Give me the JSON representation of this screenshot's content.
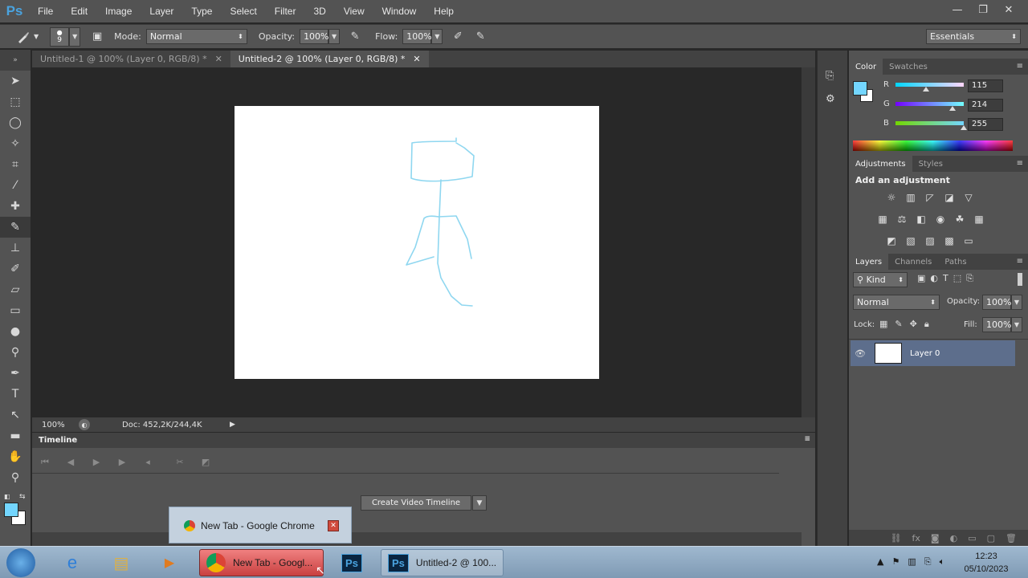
{
  "app": {
    "logo": "Ps"
  },
  "menu": [
    "File",
    "Edit",
    "Image",
    "Layer",
    "Type",
    "Select",
    "Filter",
    "3D",
    "View",
    "Window",
    "Help"
  ],
  "window_controls": {
    "minimize": "—",
    "restore": "❐",
    "close": "✕"
  },
  "options": {
    "brush_size": "9",
    "mode_label": "Mode:",
    "mode_value": "Normal",
    "opacity_label": "Opacity:",
    "opacity_value": "100%",
    "flow_label": "Flow:",
    "flow_value": "100%",
    "workspace": "Essentials"
  },
  "doc_tabs": [
    {
      "label": "Untitled-1 @ 100% (Layer 0, RGB/8) *",
      "close": "✕"
    },
    {
      "label": "Untitled-2 @ 100% (Layer 0, RGB/8) *",
      "close": "✕"
    }
  ],
  "status": {
    "zoom": "100%",
    "doc": "Doc: 452,2K/244,4K"
  },
  "timeline": {
    "title": "Timeline",
    "create_button": "Create Video Timeline"
  },
  "color_panel": {
    "tabs": [
      "Color",
      "Swatches"
    ],
    "r_label": "R",
    "r_value": "115",
    "g_label": "G",
    "g_value": "214",
    "b_label": "B",
    "b_value": "255",
    "foreground": "#73d6ff"
  },
  "adjustments_panel": {
    "tabs": [
      "Adjustments",
      "Styles"
    ],
    "heading": "Add an adjustment"
  },
  "layers_panel": {
    "tabs": [
      "Layers",
      "Channels",
      "Paths"
    ],
    "filter_kind": "Kind",
    "blend_mode": "Normal",
    "opacity_label": "Opacity:",
    "opacity_value": "100%",
    "lock_label": "Lock:",
    "fill_label": "Fill:",
    "fill_value": "100%",
    "layers": [
      {
        "name": "Layer 0"
      }
    ]
  },
  "taskbar": {
    "chrome_button": "New Tab - Googl...",
    "ps_window_button": "Untitled-2 @ 100...",
    "popup_title": "New Tab - Google Chrome",
    "clock_time": "12:23",
    "clock_date": "05/10/2023"
  }
}
